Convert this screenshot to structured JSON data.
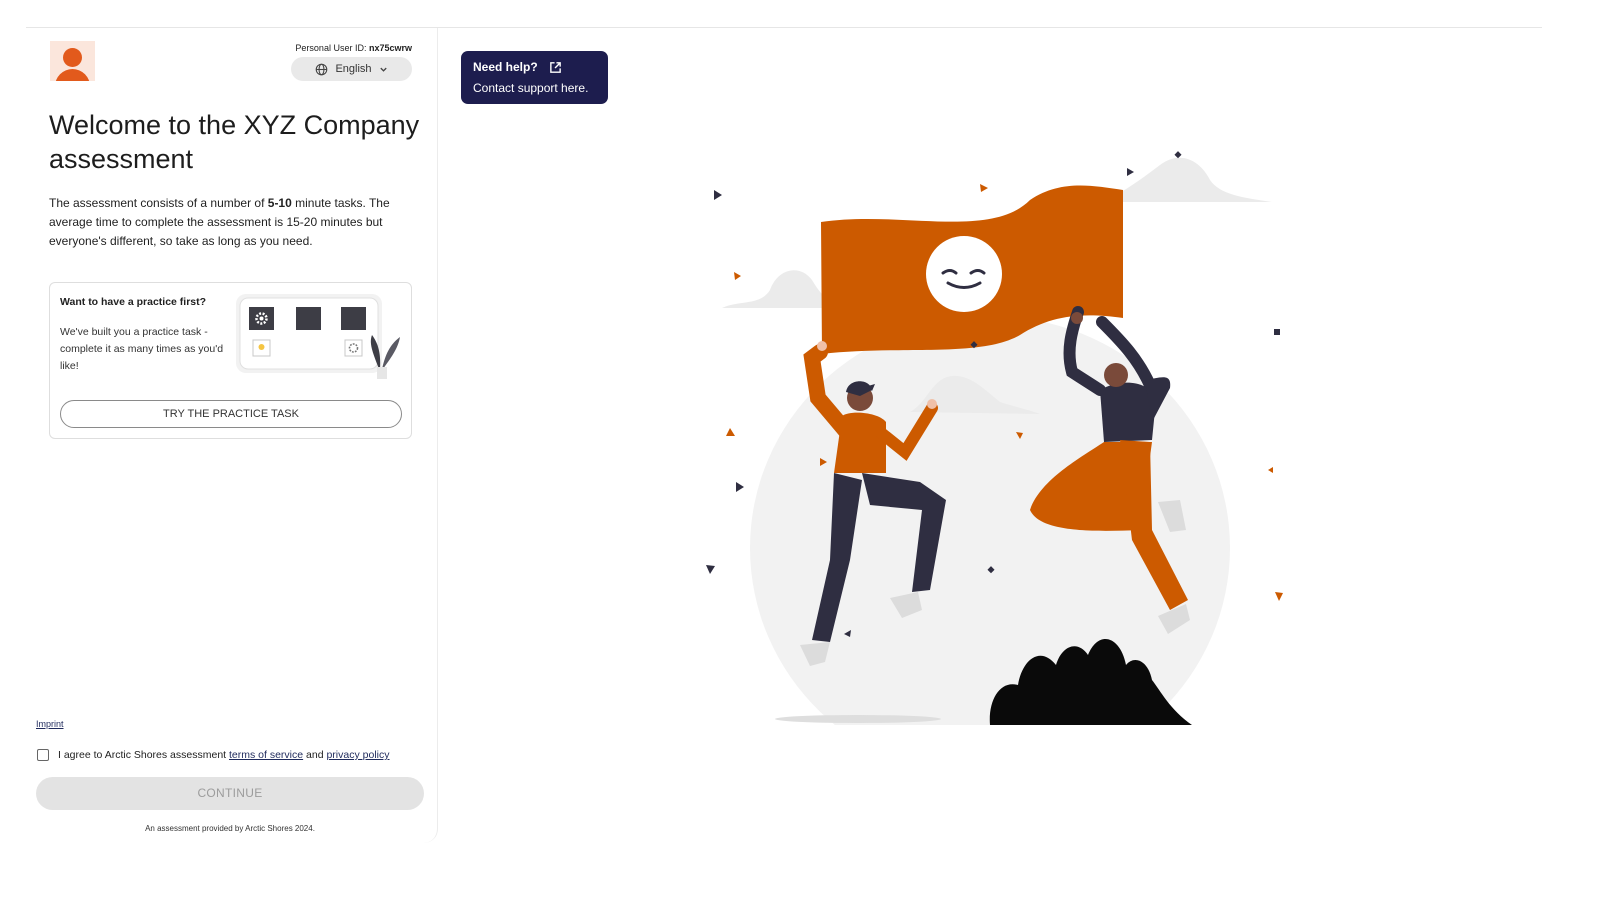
{
  "header": {
    "user_id_label": "Personal User ID:",
    "user_id_value": "nx75cwrw",
    "language": "English"
  },
  "main": {
    "title": "Welcome to the XYZ Company assessment",
    "intro_part1": "The assessment consists of a number of ",
    "intro_bold": "5-10",
    "intro_part2": " minute tasks. The average time to complete the assessment is 15-20 minutes but everyone's different, so take as long as you need."
  },
  "practice": {
    "title": "Want to have a practice first?",
    "description": "We've built you a practice task - complete it as many times as you'd like!",
    "button_label": "TRY THE PRACTICE TASK"
  },
  "footer": {
    "imprint": "Imprint",
    "agree_prefix": "I agree to Arctic Shores assessment ",
    "terms_link": "terms of service",
    "agree_and": " and ",
    "privacy_link": "privacy policy",
    "continue_label": "CONTINUE",
    "provided_by": "An assessment provided by Arctic Shores 2024."
  },
  "help": {
    "title": "Need help?",
    "subtitle": "Contact support here."
  },
  "colors": {
    "accent_orange": "#cc5a00",
    "help_bg": "#1d1d4e",
    "dark_navy": "#2f2e41"
  },
  "icons": {
    "language": "globe-icon",
    "dropdown": "chevron-down-icon",
    "help": "external-link-icon"
  }
}
